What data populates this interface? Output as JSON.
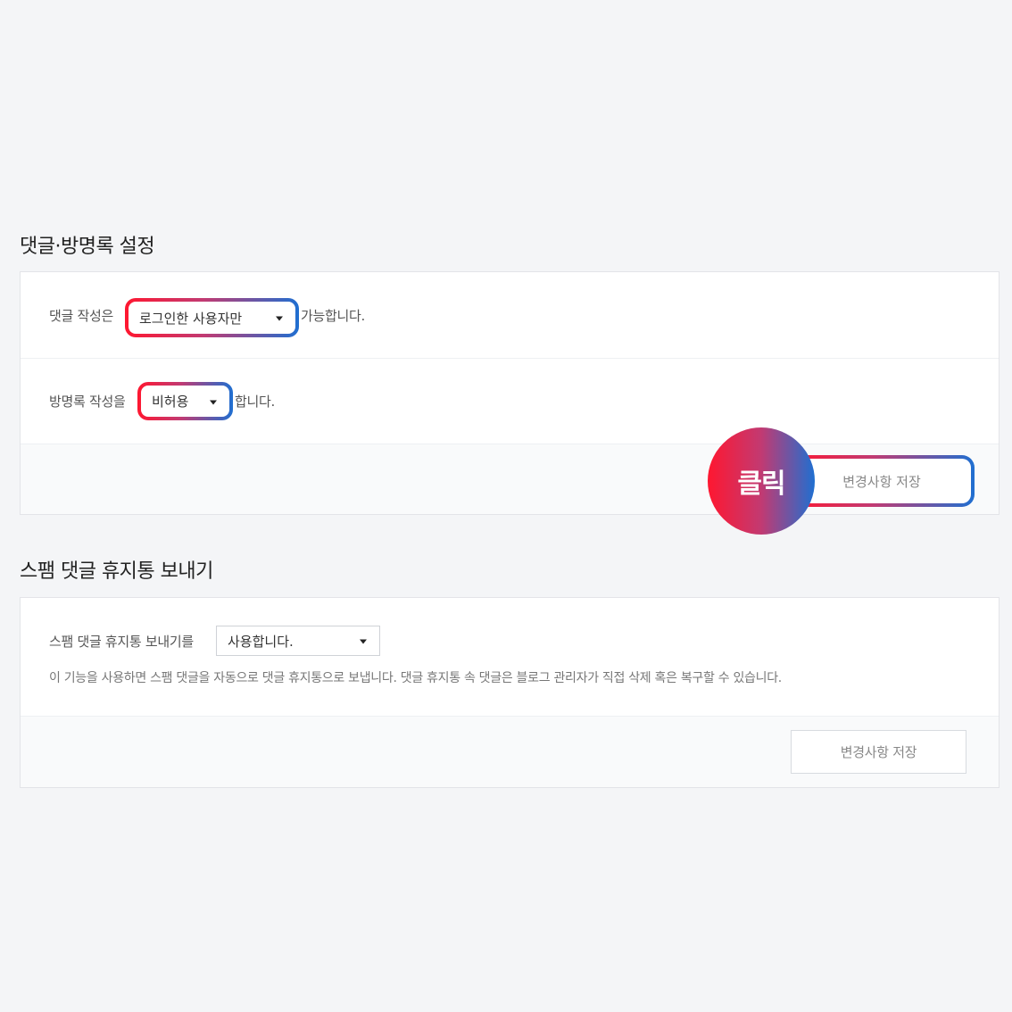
{
  "section1": {
    "title": "댓글·방명록 설정",
    "comment_row": {
      "prefix": "댓글 작성은",
      "select_value": "로그인한 사용자만",
      "suffix": "가능합니다."
    },
    "guestbook_row": {
      "prefix": "방명록 작성을",
      "select_value": "비허용",
      "suffix": "합니다."
    },
    "save_label": "변경사항 저장",
    "click_badge": "클릭"
  },
  "section2": {
    "title": "스팸 댓글 휴지통 보내기",
    "spam_row": {
      "prefix": "스팸 댓글 휴지통 보내기를",
      "select_value": "사용합니다."
    },
    "description": "이 기능을 사용하면 스팸 댓글을 자동으로 댓글 휴지통으로 보냅니다. 댓글 휴지통 속 댓글은 블로그 관리자가 직접 삭제 혹은 복구할 수 있습니다.",
    "save_label": "변경사항 저장"
  },
  "colors": {
    "highlight_start": "#ff1730",
    "highlight_end": "#1f6fd1",
    "background": "#f4f5f7"
  }
}
